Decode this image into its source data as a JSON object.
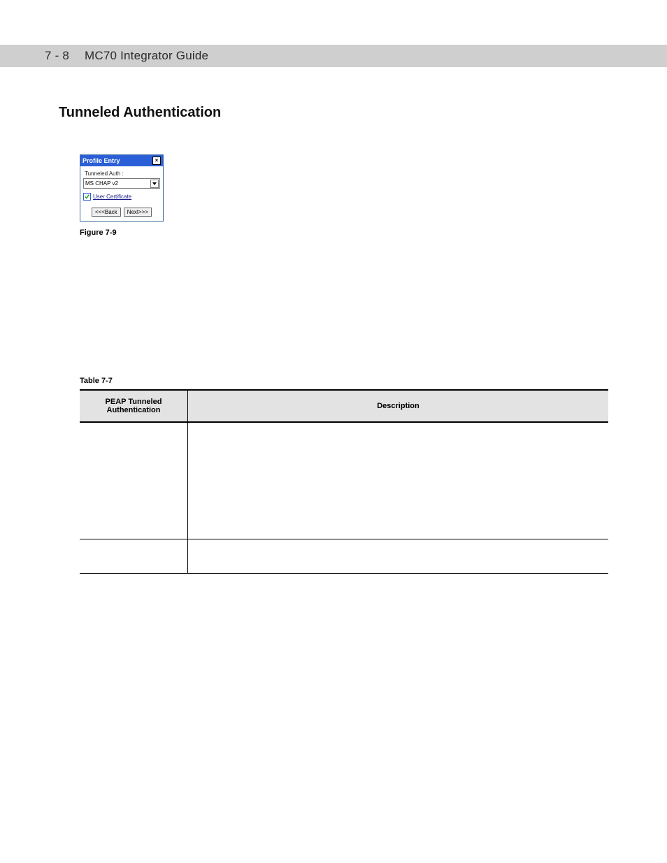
{
  "header": {
    "page_num": "7 - 8",
    "doc_title": "MC70 Integrator Guide"
  },
  "section": {
    "heading": "Tunneled Authentication"
  },
  "dialog": {
    "title": "Profile Entry",
    "group_label": "Tunneled Auth :",
    "combo_value": "MS CHAP v2",
    "user_cert_label": "User Certificate",
    "back_label": "<<<Back",
    "next_label": "Next>>>"
  },
  "figure": {
    "caption": "Figure 7-9"
  },
  "table": {
    "caption": "Table 7-7",
    "head": {
      "c1": "PEAP Tunneled Authentication",
      "c2": "Description"
    }
  }
}
